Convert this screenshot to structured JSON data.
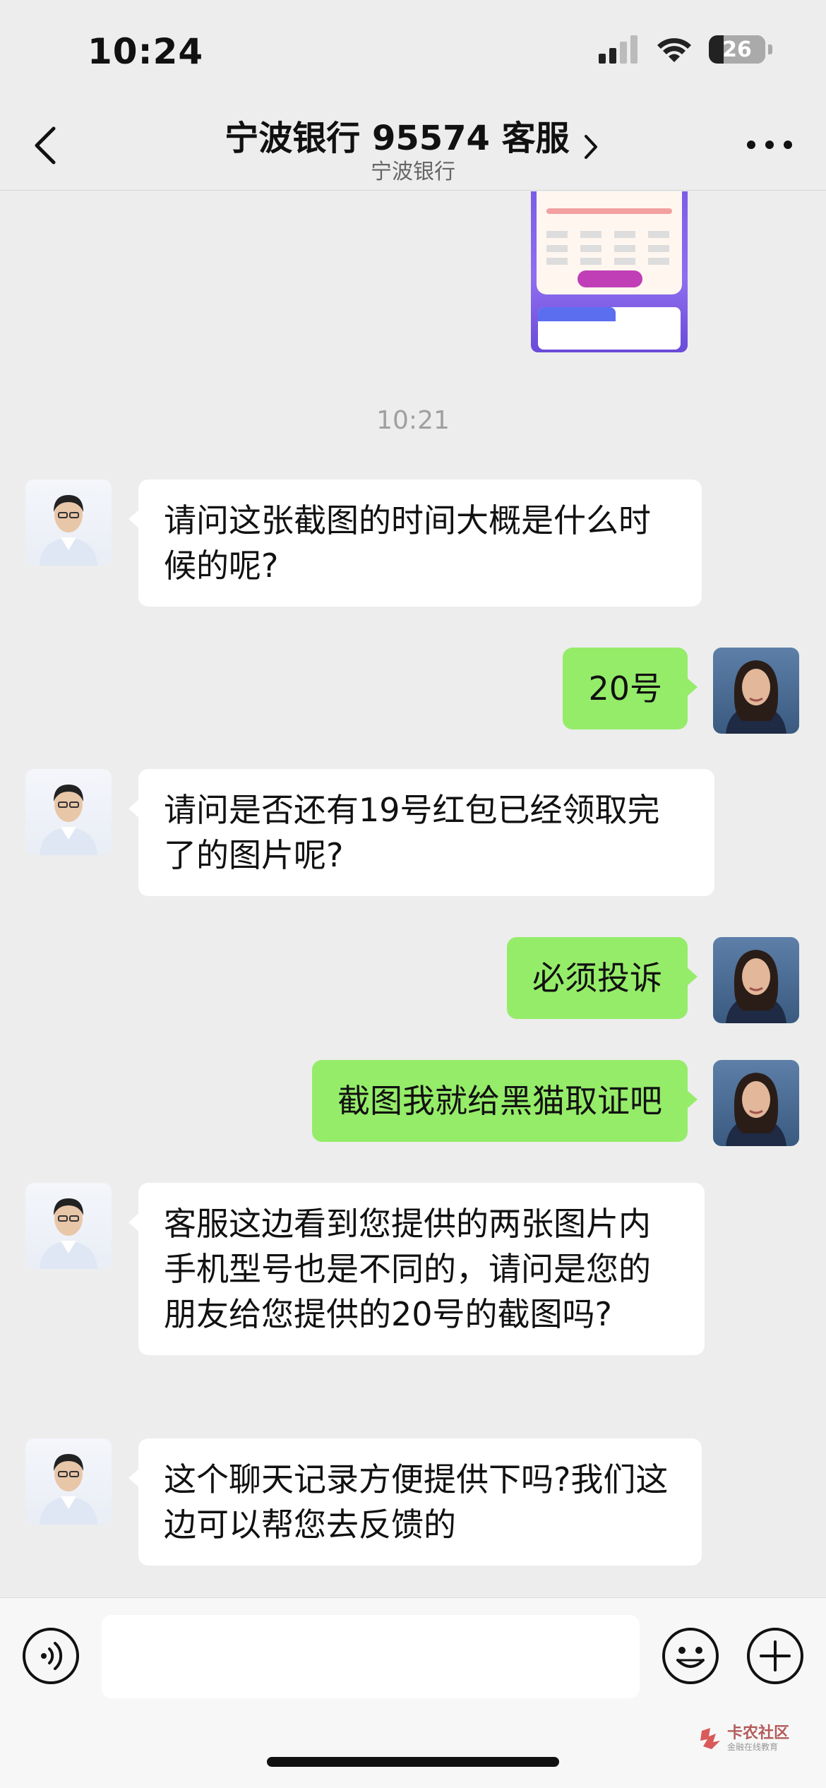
{
  "status_bar": {
    "time": "10:24",
    "battery": "26",
    "battery_level": 0.26
  },
  "header": {
    "title": "宁波银行 95574 客服",
    "subtitle": "宁波银行"
  },
  "chat": {
    "timestamp": "10:21",
    "messages": [
      {
        "sender": "agent",
        "text": "请问这张截图的时间大概是什么时候的呢?"
      },
      {
        "sender": "user",
        "text": "20号"
      },
      {
        "sender": "agent",
        "text": "请问是否还有19号红包已经领取完了的图片呢?"
      },
      {
        "sender": "user",
        "text": "必须投诉"
      },
      {
        "sender": "user",
        "text": "截图我就给黑猫取证吧"
      },
      {
        "sender": "agent",
        "text": "客服这边看到您提供的两张图片内手机型号也是不同的，请问是您的朋友给您提供的20号的截图吗?"
      },
      {
        "sender": "agent",
        "text": "这个聊天记录方便提供下吗?我们这边可以帮您去反馈的"
      }
    ]
  },
  "input_bar": {
    "text_value": ""
  },
  "watermark": {
    "title": "卡农社区",
    "subtitle": "金融在线教育"
  },
  "colors": {
    "background": "#ededed",
    "outgoing_bubble": "#95ec69",
    "incoming_bubble": "#ffffff"
  }
}
